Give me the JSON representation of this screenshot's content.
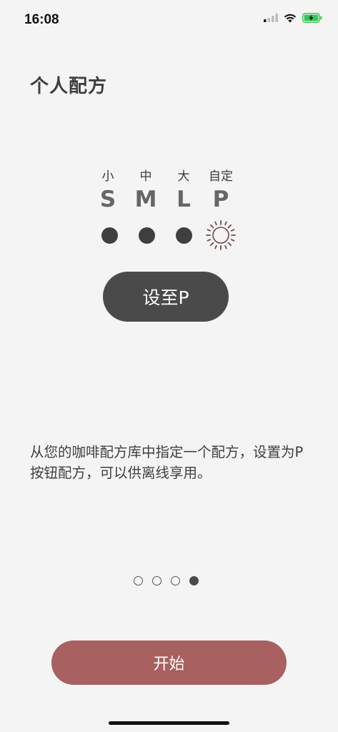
{
  "status_bar": {
    "time": "16:08"
  },
  "header": {
    "title": "个人配方"
  },
  "sizes": [
    {
      "label_cn": "小",
      "letter": "S"
    },
    {
      "label_cn": "中",
      "letter": "M"
    },
    {
      "label_cn": "大",
      "letter": "L"
    },
    {
      "label_cn": "自定",
      "letter": "P"
    }
  ],
  "main": {
    "set_button_label": "设至P",
    "description": "从您的咖啡配方库中指定一个配方，设置为P按钮配方，可以供离线享用。"
  },
  "pager": {
    "total": 4,
    "active_index": 3
  },
  "footer": {
    "start_label": "开始"
  },
  "colors": {
    "background": "#f5f4f4",
    "dark": "#4a4a4a",
    "accent": "#a86060",
    "sun": "#6b4a4a",
    "battery": "#35c759"
  },
  "icons": {
    "custom_size": "sun-icon"
  }
}
